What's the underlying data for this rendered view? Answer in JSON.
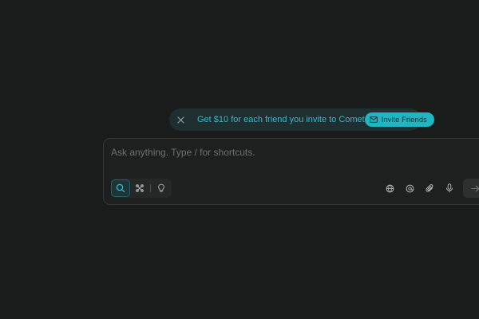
{
  "promo": {
    "text": "Get $10 for each friend you invite to Comet",
    "button_label": "Invite Friends",
    "close_icon": "close-icon",
    "button_icon": "mail-icon"
  },
  "composer": {
    "placeholder": "Ask anything. Type / for shortcuts.",
    "value": "",
    "modes": [
      {
        "icon": "search-icon",
        "active": true
      },
      {
        "icon": "sparkle-grid-icon",
        "active": false
      },
      {
        "icon": "lightbulb-icon",
        "active": false
      }
    ],
    "tools": [
      "globe-icon",
      "at-sign-icon",
      "paperclip-icon",
      "microphone-icon"
    ],
    "submit_icon": "arrow-right-icon"
  },
  "colors": {
    "background": "#1a1c1c",
    "accent": "#1fb6c4",
    "promo_text": "#3fb6c2",
    "composer_bg": "#1e2020"
  }
}
